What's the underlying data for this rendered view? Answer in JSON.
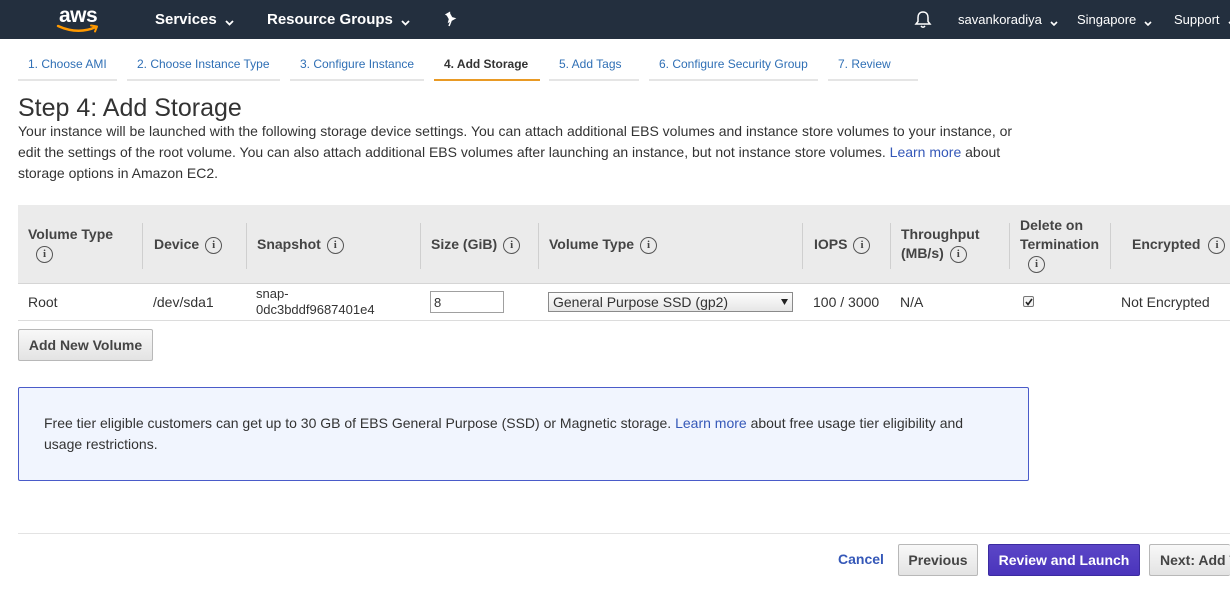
{
  "nav": {
    "logo_text": "aws",
    "services": "Services",
    "resource_groups": "Resource Groups",
    "user": "savankoradiya",
    "region": "Singapore",
    "support": "Support"
  },
  "tabs": [
    {
      "label": "1. Choose AMI"
    },
    {
      "label": "2. Choose Instance Type"
    },
    {
      "label": "3. Configure Instance"
    },
    {
      "label": "4. Add Storage"
    },
    {
      "label": "5. Add Tags"
    },
    {
      "label": "6. Configure Security Group"
    },
    {
      "label": "7. Review"
    }
  ],
  "page": {
    "title": "Step 4: Add Storage",
    "intro_text": "Your instance will be launched with the following storage device settings. You can attach additional EBS volumes and instance store volumes to your instance, or edit the settings of the root volume. You can also attach additional EBS volumes after launching an instance, but not instance store volumes.",
    "intro_link": "Learn more",
    "intro_after": "about storage options in Amazon EC2."
  },
  "table": {
    "headers": {
      "volume_type_1": "Volume Type",
      "device": "Device",
      "snapshot": "Snapshot",
      "size": "Size (GiB)",
      "volume_type_2": "Volume Type",
      "iops": "IOPS",
      "throughput_1": "Throughput",
      "throughput_2": "(MB/s)",
      "delete_1": "Delete on",
      "delete_2": "Termination",
      "encrypted": "Encrypted",
      "info_glyph": "i"
    },
    "row": {
      "volume_type": "Root",
      "device": "/dev/sda1",
      "snapshot_1": "snap-",
      "snapshot_2": "0dc3bddf9687401e4",
      "size": "8",
      "ebs_type": "General Purpose SSD (gp2)",
      "iops": "100 / 3000",
      "throughput": "N/A",
      "delete_on_termination": true,
      "encrypted": "Not Encrypted"
    }
  },
  "add_volume_button": "Add New Volume",
  "notice": {
    "text": "Free tier eligible customers can get up to 30 GB of EBS General Purpose (SSD) or Magnetic storage.",
    "link": "Learn more",
    "after": "about free usage tier eligibility and usage restrictions."
  },
  "footer": {
    "cancel": "Cancel",
    "previous": "Previous",
    "review_launch": "Review and Launch",
    "next": "Next: Add Tags"
  },
  "colors": {
    "nav_bg": "#232f3e",
    "link": "#3558b8",
    "active_tab": "#e99a24",
    "primary_button": "#4a34bb",
    "notice_border": "#4a5bc9"
  }
}
